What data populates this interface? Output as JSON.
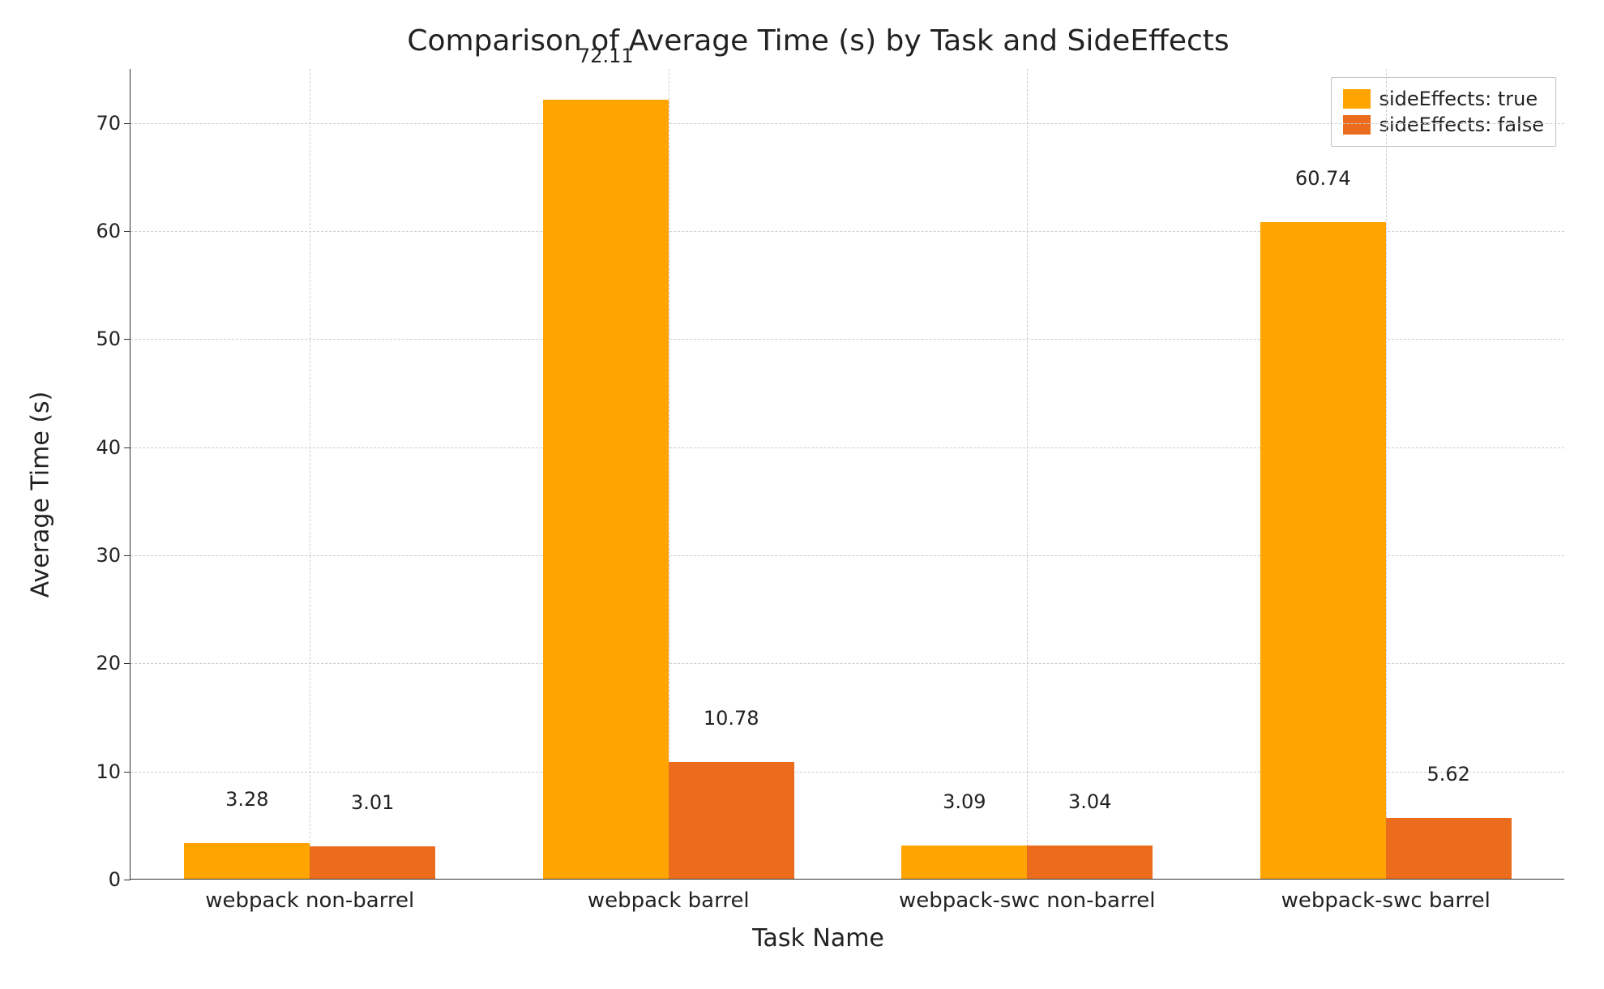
{
  "chart_data": {
    "type": "bar",
    "title": "Comparison of Average Time (s) by Task and SideEffects",
    "xlabel": "Task Name",
    "ylabel": "Average Time (s)",
    "categories": [
      "webpack non-barrel",
      "webpack barrel",
      "webpack-swc non-barrel",
      "webpack-swc barrel"
    ],
    "series": [
      {
        "name": "sideEffects: true",
        "color": "#ffa400",
        "values": [
          3.28,
          72.11,
          3.09,
          60.74
        ]
      },
      {
        "name": "sideEffects: false",
        "color": "#ec6c1d",
        "values": [
          3.01,
          10.78,
          3.04,
          5.62
        ]
      }
    ],
    "y_ticks": [
      0,
      10,
      20,
      30,
      40,
      50,
      60,
      70
    ],
    "ylim": [
      0,
      75
    ],
    "grid": true,
    "legend_position": "upper right"
  }
}
